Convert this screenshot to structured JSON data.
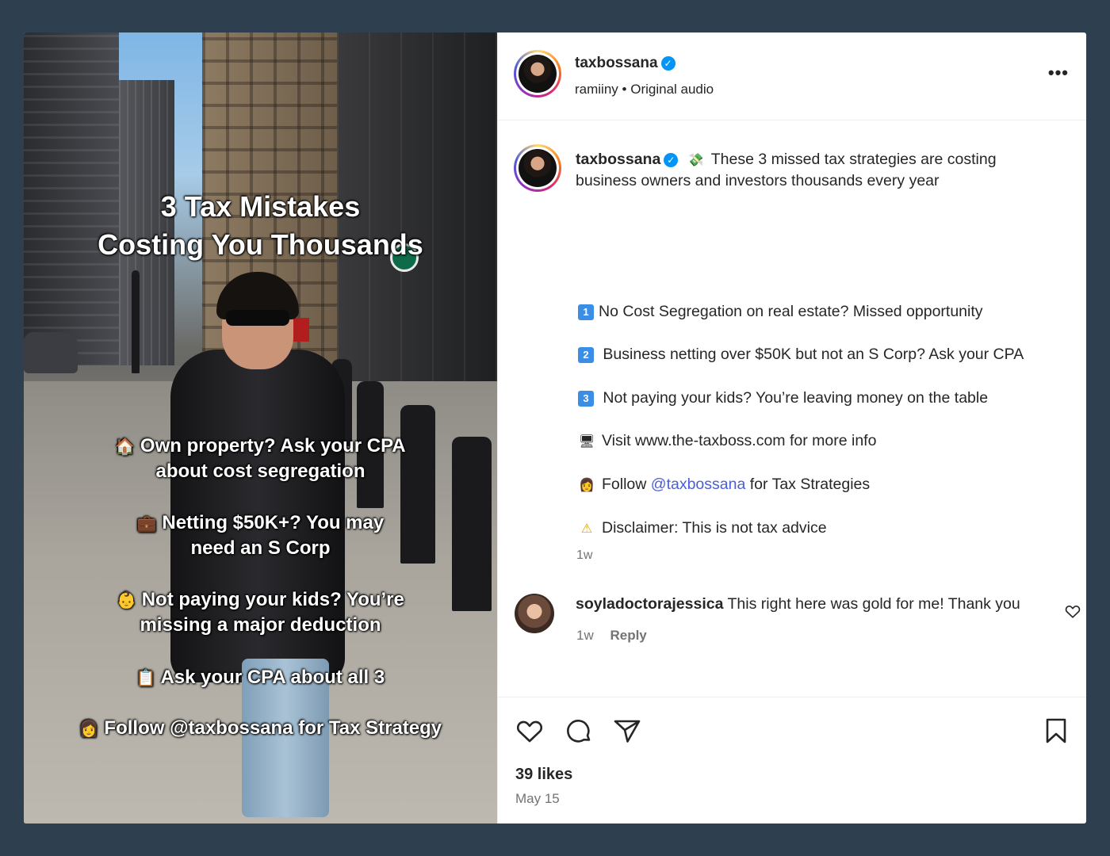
{
  "media": {
    "title_line1": "3 Tax Mistakes",
    "title_line2": "Costing You Thousands",
    "bullets": [
      {
        "icon": "house-icon",
        "emoji": "🏠",
        "line1": "Own property? Ask your CPA",
        "line2": "about cost segregation"
      },
      {
        "icon": "briefcase-icon",
        "emoji": "💼",
        "line1": "Netting $50K+? You may",
        "line2": "need an S Corp"
      },
      {
        "icon": "baby-icon",
        "emoji": "👶",
        "line1": "Not paying your kids? You’re",
        "line2": "missing a major deduction"
      },
      {
        "icon": "clipboard-icon",
        "emoji": "📋",
        "line1": "Ask your CPA about all 3",
        "line2": ""
      },
      {
        "icon": "woman-icon",
        "emoji": "👩",
        "line1": "Follow @taxbossana for Tax Strategy",
        "line2": ""
      }
    ]
  },
  "header": {
    "username": "taxbossana",
    "audio_user": "ramiiny",
    "audio_separator": "•",
    "audio_label": "Original audio",
    "more_label": "•••"
  },
  "caption": {
    "username": "taxbossana",
    "emoji": "💸",
    "text": "These 3 missed tax strategies are costing business owners and investors thousands every year",
    "lines": [
      {
        "icon": "keycap-1-icon",
        "glyph": "1",
        "text": "No Cost Segregation on real estate? Missed opportunity"
      },
      {
        "icon": "keycap-2-icon",
        "glyph": "2",
        "text": "Business netting over $50K but not an S Corp? Ask your CPA"
      },
      {
        "icon": "keycap-3-icon",
        "glyph": "3",
        "text": "Not paying your kids? You’re leaving money on the table"
      },
      {
        "icon": "computer-icon",
        "glyph": "🖥",
        "text": "Visit www.the-taxboss.com for more info"
      },
      {
        "icon": "woman-icon",
        "glyph": "👩",
        "text_before": "Follow ",
        "mention": "@taxbossana",
        "text_after": " for Tax Strategies"
      },
      {
        "icon": "warning-icon",
        "glyph": "⚠",
        "text": "Disclaimer: This is not tax advice"
      }
    ],
    "time": "1w"
  },
  "comment": {
    "username": "soyladoctorajessica",
    "text": "This right here was gold for me! Thank you",
    "time": "1w",
    "reply_label": "Reply"
  },
  "footer": {
    "likes": "39 likes",
    "date": "May 15"
  },
  "colors": {
    "background": "#2e3f50",
    "verified": "#0095f6",
    "mention": "#4a5fd6",
    "muted": "#737373"
  }
}
